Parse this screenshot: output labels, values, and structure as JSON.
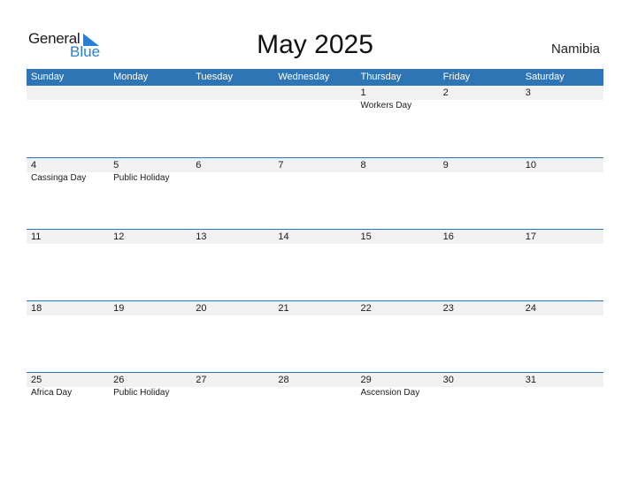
{
  "brand": {
    "word1": "General",
    "word2": "Blue",
    "accent": "#2e75b6"
  },
  "header": {
    "title": "May 2025",
    "country": "Namibia"
  },
  "weekdays": [
    "Sunday",
    "Monday",
    "Tuesday",
    "Wednesday",
    "Thursday",
    "Friday",
    "Saturday"
  ],
  "weeks": [
    {
      "dates": [
        "",
        "",
        "",
        "",
        "1",
        "2",
        "3"
      ],
      "holidays": [
        "",
        "",
        "",
        "",
        "Workers Day",
        "",
        ""
      ]
    },
    {
      "dates": [
        "4",
        "5",
        "6",
        "7",
        "8",
        "9",
        "10"
      ],
      "holidays": [
        "Cassinga Day",
        "Public Holiday",
        "",
        "",
        "",
        "",
        ""
      ]
    },
    {
      "dates": [
        "11",
        "12",
        "13",
        "14",
        "15",
        "16",
        "17"
      ],
      "holidays": [
        "",
        "",
        "",
        "",
        "",
        "",
        ""
      ]
    },
    {
      "dates": [
        "18",
        "19",
        "20",
        "21",
        "22",
        "23",
        "24"
      ],
      "holidays": [
        "",
        "",
        "",
        "",
        "",
        "",
        ""
      ]
    },
    {
      "dates": [
        "25",
        "26",
        "27",
        "28",
        "29",
        "30",
        "31"
      ],
      "holidays": [
        "Africa Day",
        "Public Holiday",
        "",
        "",
        "Ascension Day",
        "",
        ""
      ]
    }
  ]
}
